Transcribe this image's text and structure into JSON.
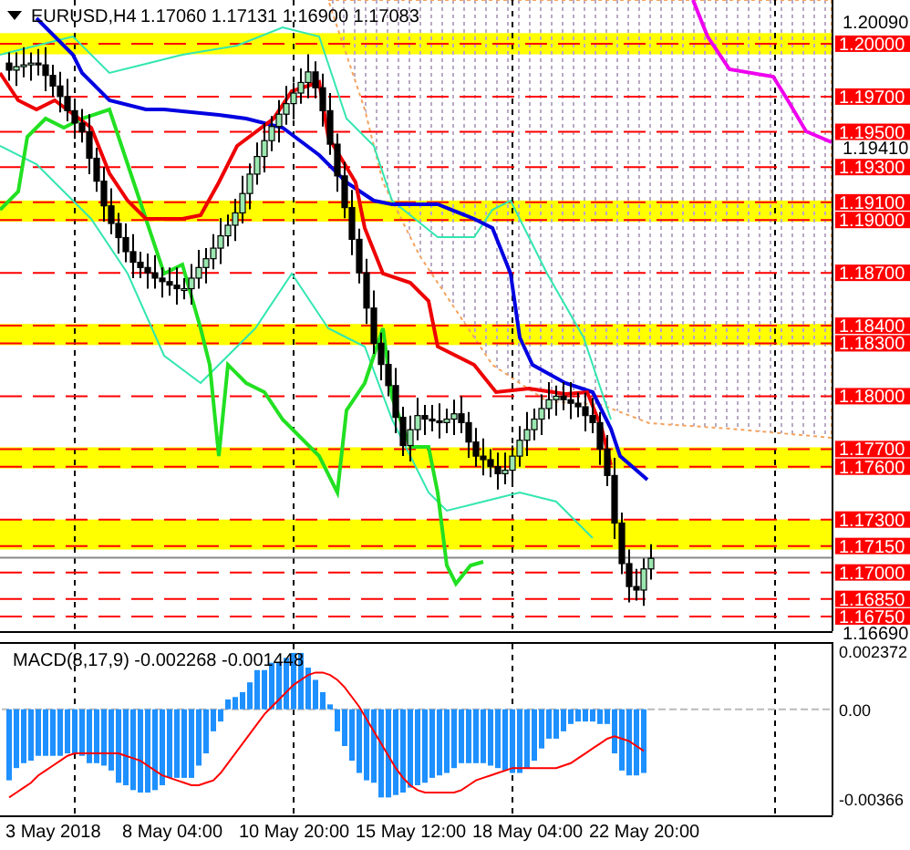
{
  "header": {
    "symbol": "EURUSD,H4",
    "prices": "1.17060 1.17131 1.16900 1.17083"
  },
  "price_axis": {
    "ticks": [
      "1.20090",
      "1.19410",
      "1.16690"
    ],
    "levels": [
      "1.20000",
      "1.19700",
      "1.19500",
      "1.19300",
      "1.19100",
      "1.19000",
      "1.18700",
      "1.18400",
      "1.18300",
      "1.18000",
      "1.17700",
      "1.17600",
      "1.17300",
      "1.17150",
      "1.17000",
      "1.16850",
      "1.16750"
    ]
  },
  "macd": {
    "title": "MACD(8,17,9) -0.002268 -0.001448",
    "ticks": [
      "0.002372",
      "0.00",
      "-0.00366"
    ]
  },
  "x_axis": {
    "labels": [
      "3 May 2018",
      "8 May 04:00",
      "10 May 20:00",
      "15 May 12:00",
      "18 May 04:00",
      "22 May 20:00"
    ]
  }
}
